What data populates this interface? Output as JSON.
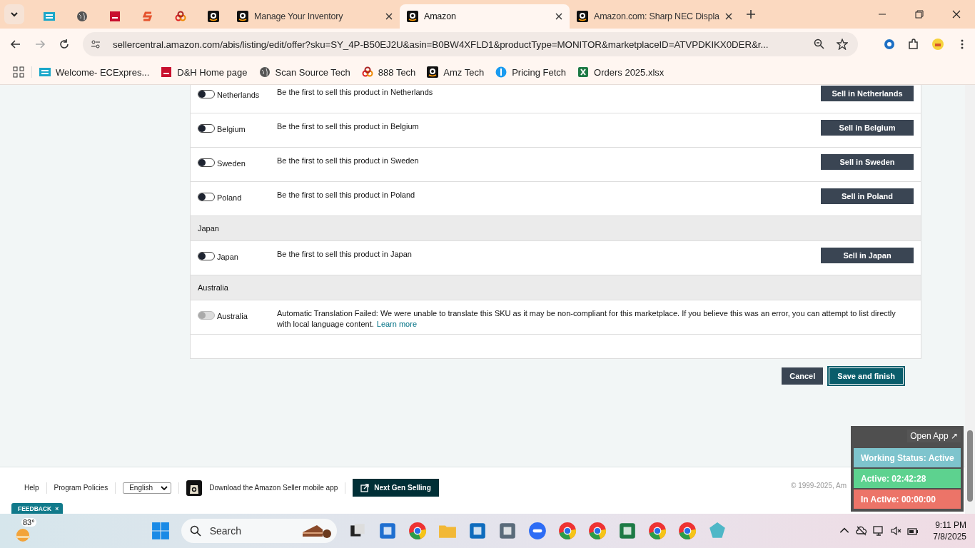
{
  "browser": {
    "tabs": [
      {
        "kind": "pinned",
        "selected": false
      },
      {
        "kind": "pinned",
        "selected": false
      },
      {
        "kind": "pinned",
        "selected": false
      },
      {
        "kind": "pinned",
        "selected": false
      },
      {
        "kind": "pinned",
        "selected": false
      },
      {
        "kind": "pinned",
        "selected": false
      },
      {
        "kind": "normal",
        "label": "Manage Your Inventory",
        "selected": false
      },
      {
        "kind": "normal",
        "label": "Amazon",
        "selected": true
      },
      {
        "kind": "normal",
        "label": "Amazon.com: Sharp NEC Displa",
        "selected": false
      }
    ],
    "url": "sellercentral.amazon.com/abis/listing/edit/offer?sku=SY_4P-B50EJ2U&asin=B0BW4XFLD1&productType=MONITOR&marketplaceID=ATVPDKIKX0DER&r...",
    "bookmarks": [
      "Welcome- ECExpres...",
      "D&H Home page",
      "Scan Source Tech",
      "888 Tech",
      "Amz Tech",
      "Pricing Fetch",
      "Orders 2025.xlsx"
    ]
  },
  "rows": [
    {
      "kind": "marketplace",
      "country": "Netherlands",
      "on": false,
      "disabled": false,
      "message": "Be the first to sell this product in Netherlands",
      "button": "Sell in Netherlands"
    },
    {
      "kind": "marketplace",
      "country": "Belgium",
      "on": false,
      "disabled": false,
      "message": "Be the first to sell this product in Belgium",
      "button": "Sell in Belgium"
    },
    {
      "kind": "marketplace",
      "country": "Sweden",
      "on": false,
      "disabled": false,
      "message": "Be the first to sell this product in Sweden",
      "button": "Sell in Sweden"
    },
    {
      "kind": "marketplace",
      "country": "Poland",
      "on": false,
      "disabled": false,
      "message": "Be the first to sell this product in Poland",
      "button": "Sell in Poland"
    },
    {
      "kind": "section",
      "title": "Japan"
    },
    {
      "kind": "marketplace",
      "country": "Japan",
      "on": false,
      "disabled": false,
      "message": "Be the first to sell this product in Japan",
      "button": "Sell in Japan"
    },
    {
      "kind": "section",
      "title": "Australia"
    },
    {
      "kind": "marketplace",
      "country": "Australia",
      "on": false,
      "disabled": true,
      "message": "Automatic Translation Failed: We were unable to translate this SKU as it may be non-compliant for this marketplace. If you believe this was an error, you can attempt to list directly with local language content.",
      "link": "Learn more"
    }
  ],
  "actions": {
    "cancel": "Cancel",
    "save": "Save and finish"
  },
  "footer": {
    "links": [
      "Help",
      "Program Policies"
    ],
    "language": "English",
    "app_text": "Download the Amazon Seller mobile app",
    "next_gen": "Next Gen Selling",
    "feedback": "FEEDBACK",
    "feedback_close": "×",
    "copyright": "© 1999-2025, Am"
  },
  "widget": {
    "open_app": "Open App ↗",
    "statuses": [
      {
        "label": "Working Status: Active",
        "color": "#7ec4cd"
      },
      {
        "label": "Active: 02:42:28",
        "color": "#5dd28f"
      },
      {
        "label": "In Active: 00:00:00",
        "color": "#ec7468"
      }
    ]
  },
  "taskbar": {
    "temperature": "83°",
    "search_placeholder": "Search",
    "time": "9:11 PM",
    "date": "7/8/2025"
  }
}
